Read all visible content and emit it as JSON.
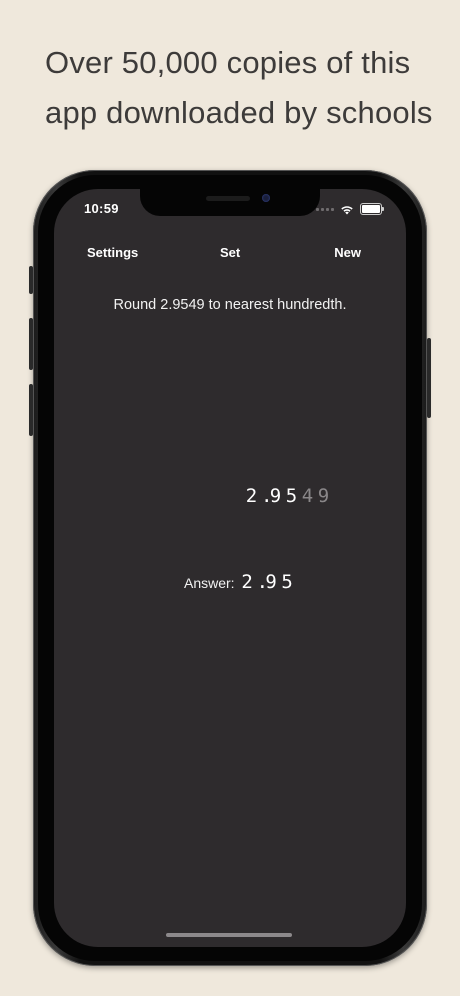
{
  "headline": {
    "line1": "Over 50,000 copies of this",
    "line2": "app downloaded by schools"
  },
  "status_bar": {
    "time": "10:59",
    "icons": [
      "signal-icon",
      "wifi-icon",
      "battery-icon"
    ],
    "battery_level": 1.0
  },
  "nav": {
    "settings_label": "Settings",
    "set_label": "Set",
    "new_label": "New"
  },
  "question": {
    "text": "Round 2.9549 to nearest hundredth."
  },
  "work": {
    "kept_digits": [
      "2",
      ".",
      "9",
      "5"
    ],
    "dropped_digits": [
      "4",
      "9"
    ]
  },
  "answer": {
    "label": "Answer:",
    "digits": [
      "2",
      ".",
      "9",
      "5"
    ]
  },
  "colors": {
    "background": "#efe8dc",
    "screen": "#2e2b2d",
    "headline_text": "#3d3b3a",
    "dropped_digit": "#8a8789"
  }
}
